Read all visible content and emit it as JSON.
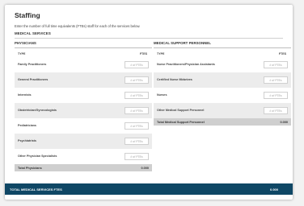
{
  "page": {
    "title": "Staffing",
    "subtitle": "Enter the number of full time equivalents (FTEs) staff for each of the services below.",
    "section": "MEDICAL SERVICES"
  },
  "physicians": {
    "header": "PHYSICIANS",
    "type_label": "TYPE",
    "ftes_label": "FTES",
    "placeholder": "# of FTEs",
    "rows": [
      {
        "label": "Family Practitioners"
      },
      {
        "label": "General Practitioners"
      },
      {
        "label": "Internists"
      },
      {
        "label": "Obstetrician/Gynecologists"
      },
      {
        "label": "Pediatricians"
      },
      {
        "label": "Psychiatrists"
      },
      {
        "label": "Other Physician Specialists"
      }
    ],
    "total_label": "Total Physicians",
    "total_value": "0.000"
  },
  "support": {
    "header": "MEDICAL SUPPORT PERSONNEL",
    "type_label": "TYPE",
    "ftes_label": "FTES",
    "placeholder": "# of FTEs",
    "rows": [
      {
        "label": "Nurse Practitioners/Physician Assistants"
      },
      {
        "label": "Certified Nurse Midwives"
      },
      {
        "label": "Nurses"
      },
      {
        "label": "Other Medical Support Personnel"
      }
    ],
    "total_label": "Total Medical Support Personnel",
    "total_value": "0.000"
  },
  "grand_total": {
    "label": "TOTAL MEDICAL SERVICES FTES",
    "value": "0.000"
  }
}
